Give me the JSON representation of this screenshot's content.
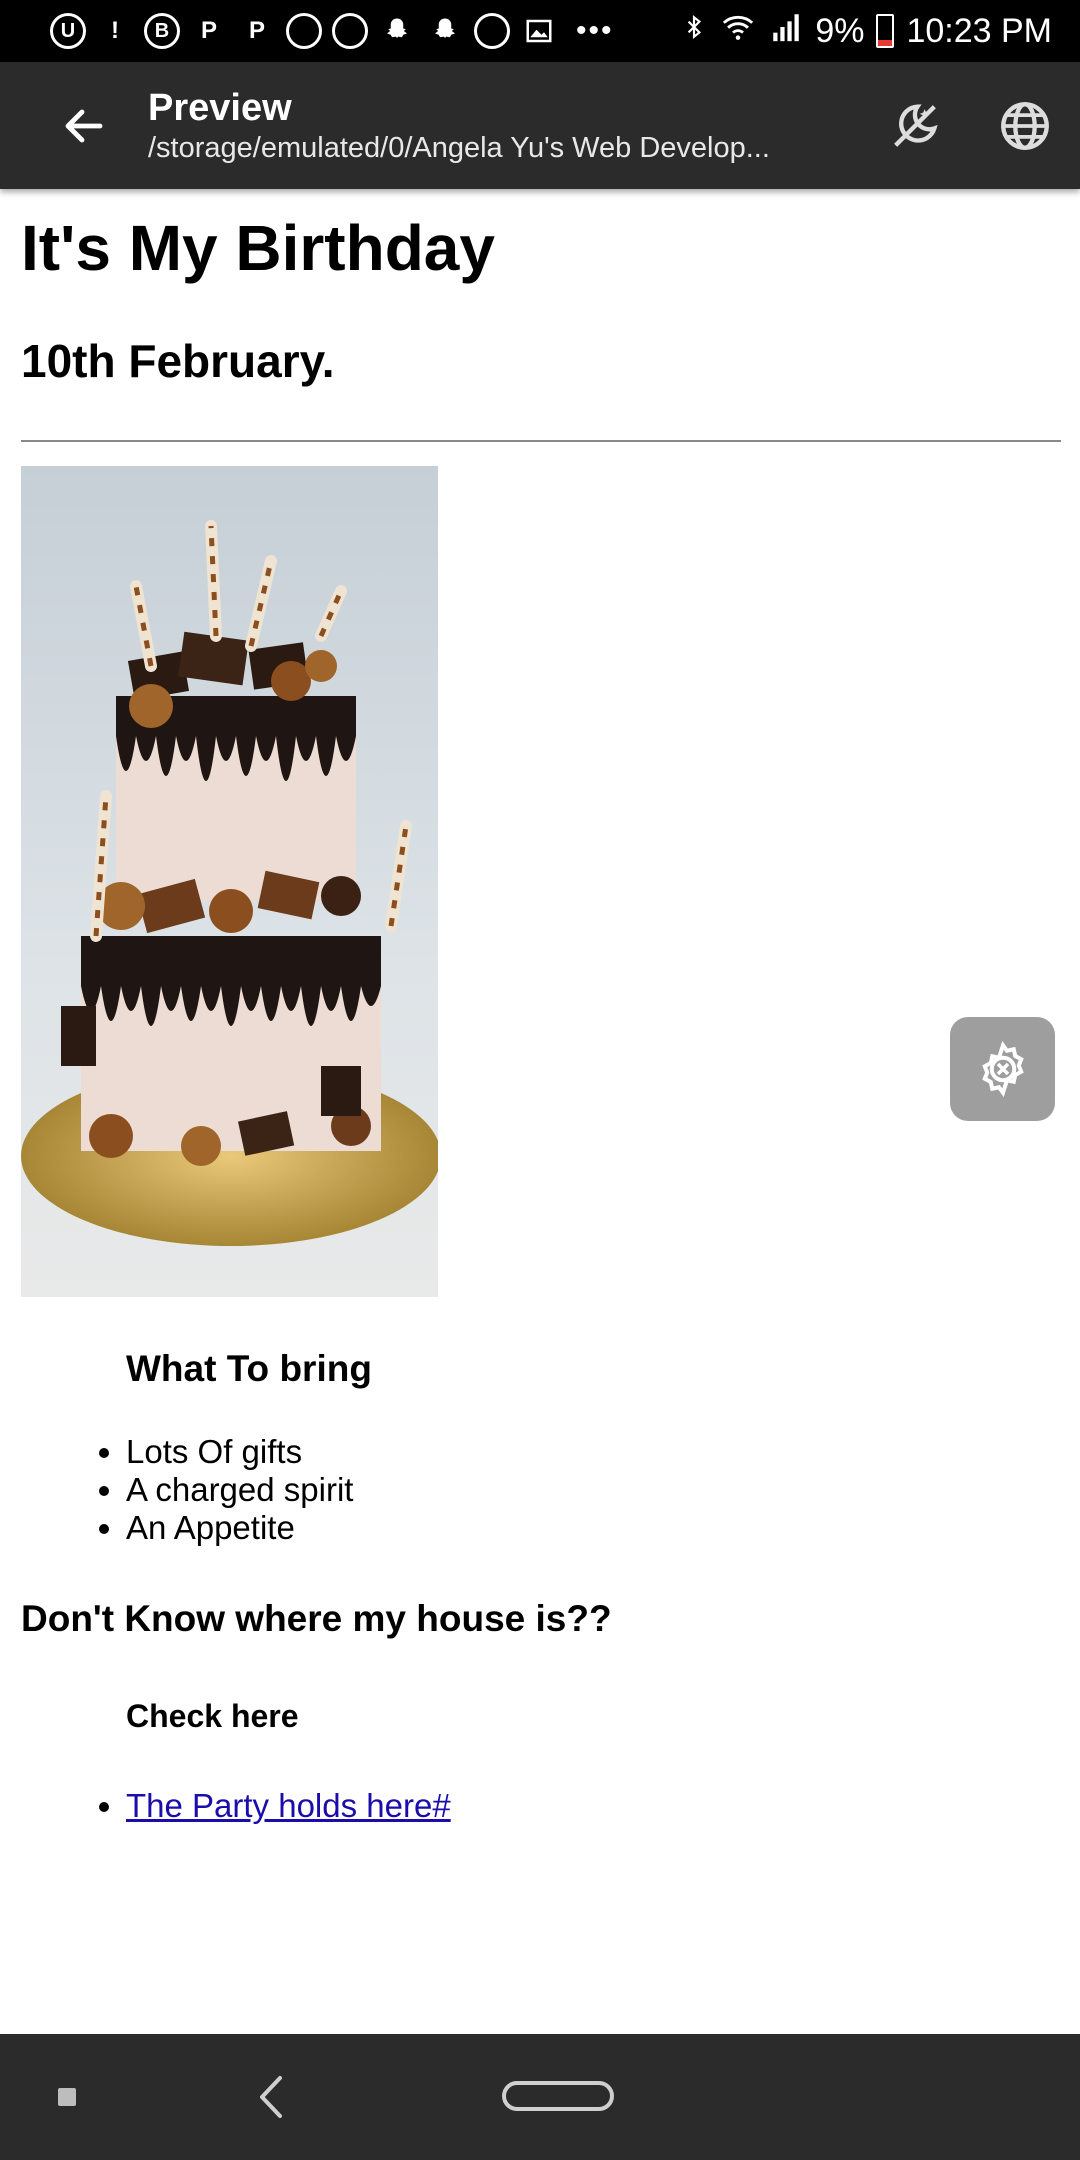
{
  "status_bar": {
    "left_icons": [
      "app-icon",
      "alert-icon",
      "b-icon",
      "p-icon",
      "p-icon",
      "o-icon",
      "o-icon",
      "snapchat-icon",
      "snapchat-icon",
      "o-icon",
      "image-icon"
    ],
    "more": "•••",
    "battery": "9%",
    "time": "10:23 PM"
  },
  "app_bar": {
    "title": "Preview",
    "subtitle": "/storage/emulated/0/Angela Yu's Web Develop...",
    "actions": [
      "night-mode-icon",
      "globe-icon"
    ]
  },
  "page": {
    "title": "It's My Birthday",
    "date": "10th February.",
    "bring_heading": "What To bring",
    "bring_items": [
      "Lots Of gifts",
      "A charged spirit",
      "An Appetite"
    ],
    "house_heading": "Don't Know where my house is??",
    "check_heading": "Check here",
    "link_text": "The Party holds here#"
  },
  "colors": {
    "status_bar": "#000000",
    "app_bar": "#2b2b2b",
    "link": "#1a0dab",
    "fab": "#9e9e9e"
  }
}
